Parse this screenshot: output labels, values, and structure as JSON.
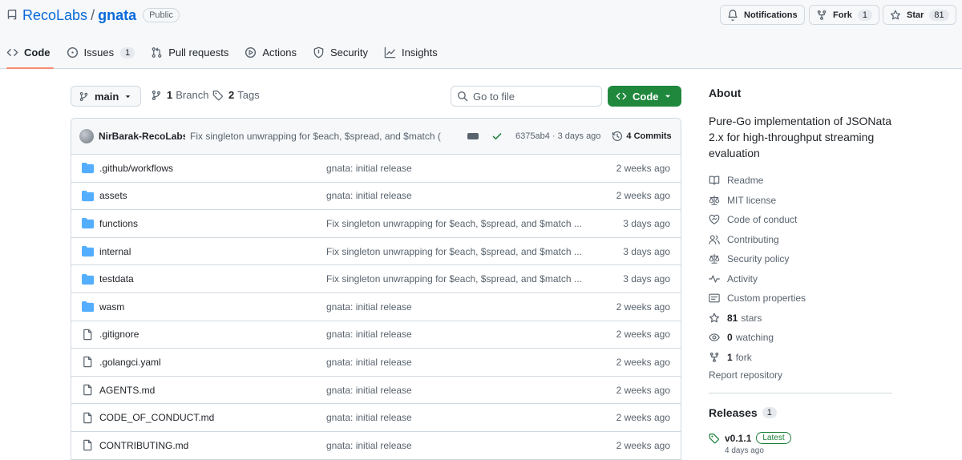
{
  "repo": {
    "owner": "RecoLabs",
    "separator": "/",
    "name": "gnata",
    "visibility": "Public"
  },
  "header_actions": {
    "notifications_label": "Notifications",
    "fork_label": "Fork",
    "fork_count": "1",
    "star_label": "Star",
    "star_count": "81"
  },
  "tabs": [
    {
      "label": "Code",
      "icon": "code-icon",
      "active": true
    },
    {
      "label": "Issues",
      "icon": "issue-icon",
      "count": "1"
    },
    {
      "label": "Pull requests",
      "icon": "pull-request-icon"
    },
    {
      "label": "Actions",
      "icon": "play-icon"
    },
    {
      "label": "Security",
      "icon": "shield-icon"
    },
    {
      "label": "Insights",
      "icon": "graph-icon"
    }
  ],
  "toolbar": {
    "branch": "main",
    "branches_count": "1",
    "branches_label": "Branch",
    "tags_count": "2",
    "tags_label": "Tags",
    "goto_placeholder": "Go to file",
    "code_button": "Code"
  },
  "latest_commit": {
    "author": "NirBarak-RecoLabs",
    "message": "Fix singleton unwrapping for $each, $spread, and $match (",
    "sha_time": "6375ab4 · 3 days ago",
    "commits_label": "4 Commits"
  },
  "files": [
    {
      "type": "folder",
      "name": ".github/workflows",
      "message": "gnata: initial release",
      "date": "2 weeks ago"
    },
    {
      "type": "folder",
      "name": "assets",
      "message": "gnata: initial release",
      "date": "2 weeks ago"
    },
    {
      "type": "folder",
      "name": "functions",
      "message": "Fix singleton unwrapping for $each, $spread, and $match ...",
      "date": "3 days ago"
    },
    {
      "type": "folder",
      "name": "internal",
      "message": "Fix singleton unwrapping for $each, $spread, and $match ...",
      "date": "3 days ago"
    },
    {
      "type": "folder",
      "name": "testdata",
      "message": "Fix singleton unwrapping for $each, $spread, and $match ...",
      "date": "3 days ago"
    },
    {
      "type": "folder",
      "name": "wasm",
      "message": "gnata: initial release",
      "date": "2 weeks ago"
    },
    {
      "type": "file",
      "name": ".gitignore",
      "message": "gnata: initial release",
      "date": "2 weeks ago"
    },
    {
      "type": "file",
      "name": ".golangci.yaml",
      "message": "gnata: initial release",
      "date": "2 weeks ago"
    },
    {
      "type": "file",
      "name": "AGENTS.md",
      "message": "gnata: initial release",
      "date": "2 weeks ago"
    },
    {
      "type": "file",
      "name": "CODE_OF_CONDUCT.md",
      "message": "gnata: initial release",
      "date": "2 weeks ago"
    },
    {
      "type": "file",
      "name": "CONTRIBUTING.md",
      "message": "gnata: initial release",
      "date": "2 weeks ago"
    }
  ],
  "about": {
    "heading": "About",
    "description": "Pure-Go implementation of JSONata 2.x for high-throughput streaming evaluation",
    "items": [
      {
        "icon": "book-icon",
        "label": "Readme"
      },
      {
        "icon": "law-icon",
        "label": "MIT license"
      },
      {
        "icon": "code-of-conduct-icon",
        "label": "Code of conduct"
      },
      {
        "icon": "people-icon",
        "label": "Contributing"
      },
      {
        "icon": "law-icon",
        "label": "Security policy"
      },
      {
        "icon": "pulse-icon",
        "label": "Activity"
      },
      {
        "icon": "note-icon",
        "label": "Custom properties"
      },
      {
        "icon": "star-icon",
        "bold": "81",
        "label": "stars"
      },
      {
        "icon": "eye-icon",
        "bold": "0",
        "label": "watching"
      },
      {
        "icon": "fork-icon",
        "bold": "1",
        "label": "fork"
      }
    ],
    "report": "Report repository"
  },
  "releases": {
    "heading": "Releases",
    "count": "1",
    "latest_tag": "v0.1.1",
    "latest_badge": "Latest",
    "latest_date": "4 days ago"
  },
  "colors": {
    "link": "#0969da",
    "primary_button": "#1f883d",
    "active_tab_underline": "#fd8c73",
    "folder": "#54aeff"
  }
}
